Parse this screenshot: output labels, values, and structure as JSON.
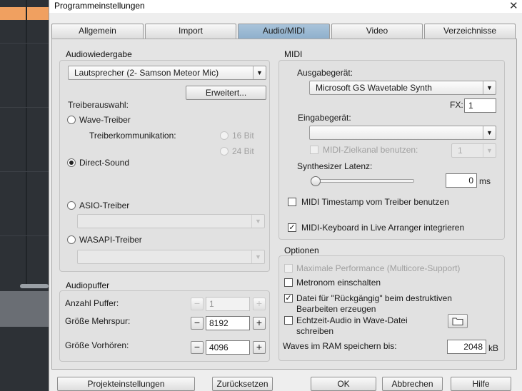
{
  "window": {
    "title": "Programmeinstellungen",
    "close_glyph": "✕"
  },
  "tabs": [
    {
      "label": "Allgemein",
      "active": false
    },
    {
      "label": "Import",
      "active": false
    },
    {
      "label": "Audio/MIDI",
      "active": true
    },
    {
      "label": "Video",
      "active": false
    },
    {
      "label": "Verzeichnisse",
      "active": false
    }
  ],
  "audio": {
    "title": "Audiowiedergabe",
    "device": "Lautsprecher (2- Samson Meteor Mic)",
    "extended_button": "Erweitert...",
    "driver_label": "Treiberauswahl:",
    "wave_driver": "Wave-Treiber",
    "driver_comm": "Treiberkommunikation:",
    "bit16": "16 Bit",
    "bit24": "24 Bit",
    "direct_sound": "Direct-Sound",
    "asio": "ASIO-Treiber",
    "wasapi": "WASAPI-Treiber",
    "selected_driver": "Direct-Sound"
  },
  "buffer": {
    "title": "Audiopuffer",
    "count_label": "Anzahl Puffer:",
    "count_value": "1",
    "multi_label": "Größe Mehrspur:",
    "multi_value": "8192",
    "preview_label": "Größe Vorhören:",
    "preview_value": "4096",
    "minus": "−",
    "plus": "+"
  },
  "midi": {
    "title": "MIDI",
    "output_label": "Ausgabegerät:",
    "output_device": "Microsoft GS Wavetable Synth",
    "fx_label": "FX:",
    "fx_value": "1",
    "input_label": "Eingabegerät:",
    "input_device": "",
    "target_channel_label": "MIDI-Zielkanal benutzen:",
    "target_channel_value": "1",
    "latency_label": "Synthesizer Latenz:",
    "latency_value": "0",
    "latency_unit": "ms",
    "latency_level": 0,
    "timestamp_label": "MIDI Timestamp vom Treiber benutzen",
    "timestamp_checked": false,
    "keyboard_label": "MIDI-Keyboard in Live Arranger integrieren",
    "keyboard_checked": true
  },
  "options": {
    "title": "Optionen",
    "max_perf": "Maximale Performance (Multicore-Support)",
    "metronome": "Metronom einschalten",
    "undo_line1": "Datei für \"Rückgängig\" beim destruktiven",
    "undo_line2": "Bearbeiten erzeugen",
    "realtime_line1": "Echtzeit-Audio in Wave-Datei",
    "realtime_line2": "schreiben",
    "ram_label": "Waves im RAM speichern bis:",
    "ram_value": "2048",
    "ram_unit": "kB",
    "check_mark": "✓"
  },
  "footer": {
    "project_settings": "Projekteinstellungen",
    "reset": "Zurücksetzen",
    "ok": "OK",
    "cancel": "Abbrechen",
    "help": "Hilfe"
  },
  "icons": {
    "dropdown": "▼",
    "folder": "folder-icon"
  }
}
